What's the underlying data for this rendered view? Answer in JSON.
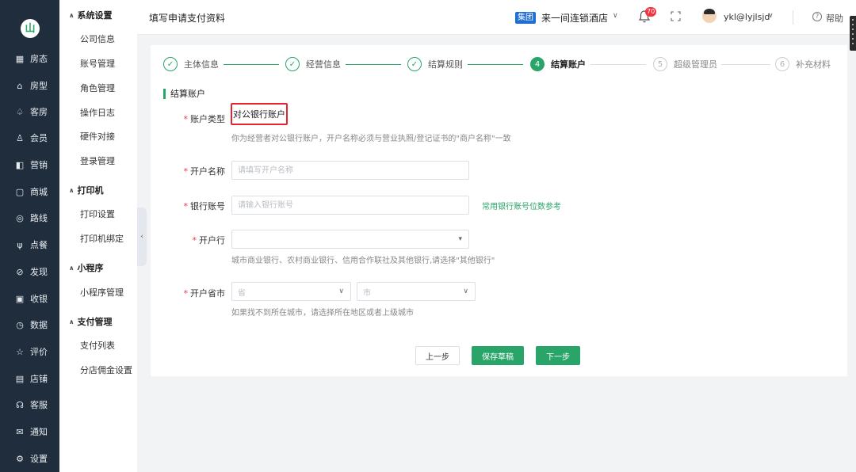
{
  "rail": {
    "logo": "山",
    "items": [
      {
        "label": "房态",
        "icon": "▦"
      },
      {
        "label": "房型",
        "icon": "⌂"
      },
      {
        "label": "客房",
        "icon": "♤"
      },
      {
        "label": "会员",
        "icon": "♙"
      },
      {
        "label": "营销",
        "icon": "◧"
      },
      {
        "label": "商城",
        "icon": "▢"
      },
      {
        "label": "路线",
        "icon": "◎"
      },
      {
        "label": "点餐",
        "icon": "ψ"
      },
      {
        "label": "发现",
        "icon": "⊘"
      },
      {
        "label": "收银",
        "icon": "▣"
      },
      {
        "label": "数据",
        "icon": "◷"
      },
      {
        "label": "评价",
        "icon": "☆"
      },
      {
        "label": "店铺",
        "icon": "▤"
      },
      {
        "label": "客服",
        "icon": "☊"
      },
      {
        "label": "通知",
        "icon": "✉"
      },
      {
        "label": "设置",
        "icon": "⚙"
      }
    ]
  },
  "side": {
    "groups": [
      {
        "title": "系统设置",
        "items": [
          "公司信息",
          "账号管理",
          "角色管理",
          "操作日志",
          "硬件对接",
          "登录管理"
        ]
      },
      {
        "title": "打印机",
        "items": [
          "打印设置",
          "打印机绑定"
        ]
      },
      {
        "title": "小程序",
        "items": [
          "小程序管理"
        ]
      },
      {
        "title": "支付管理",
        "items": [
          "支付列表",
          "分店佣金设置"
        ]
      }
    ]
  },
  "header": {
    "title": "填写申请支付资料",
    "badge": "集团",
    "hotel": "来一间连锁酒店",
    "notice_count": "70",
    "user": "ykl@lyjlsjd",
    "help": "帮助"
  },
  "steps": [
    {
      "num": "✓",
      "label": "主体信息",
      "state": "done"
    },
    {
      "num": "✓",
      "label": "经营信息",
      "state": "done"
    },
    {
      "num": "✓",
      "label": "结算规则",
      "state": "done"
    },
    {
      "num": "4",
      "label": "结算账户",
      "state": "active"
    },
    {
      "num": "5",
      "label": "超级管理员",
      "state": "todo"
    },
    {
      "num": "6",
      "label": "补充材料",
      "state": "todo"
    }
  ],
  "form": {
    "section_title": "结算账户",
    "account_type": {
      "label": "账户类型",
      "value": "对公银行账户",
      "hint": "你为经营者对公银行账户，开户名称必须与营业执照/登记证书的\"商户名称\"一致"
    },
    "account_name": {
      "label": "开户名称",
      "placeholder": "请填写开户名称"
    },
    "bank_account": {
      "label": "银行账号",
      "placeholder": "请输入银行账号",
      "link": "常用银行账号位数参考"
    },
    "bank": {
      "label": "开户行",
      "value": "",
      "hint": "城市商业银行、农村商业银行、信用合作联社及其他银行,请选择\"其他银行\""
    },
    "region": {
      "label": "开户省市",
      "province_placeholder": "省",
      "city_placeholder": "市",
      "hint": "如果找不到所在城市，请选择所在地区或者上级城市"
    }
  },
  "buttons": {
    "prev": "上一步",
    "draft": "保存草稿",
    "next": "下一步"
  },
  "colors": {
    "accent": "#2aa56a",
    "rail": "#1f2d3d",
    "highlight": "#e5252d",
    "badge": "#1f6fd1"
  }
}
